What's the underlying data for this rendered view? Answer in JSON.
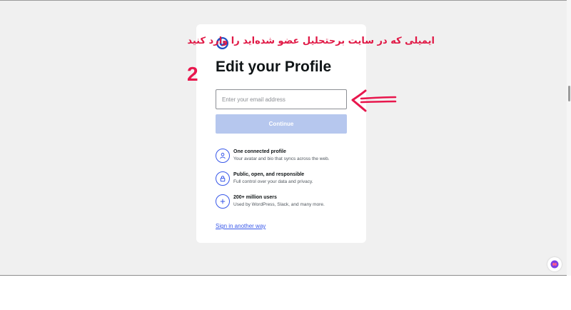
{
  "annotation": {
    "text": "ایمیلی که در سایت برحتحلیل عضو شده‌اید را وارد کنید",
    "color": "#e01845"
  },
  "step": {
    "number": "2"
  },
  "card": {
    "title": "Edit your Profile",
    "email_placeholder": "Enter your email address",
    "email_value": "",
    "continue_label": "Continue",
    "features": [
      {
        "icon": "user-icon",
        "title": "One connected profile",
        "description": "Your avatar and bio that syncs across the web."
      },
      {
        "icon": "lock-icon",
        "title": "Public, open, and responsible",
        "description": "Full control over your data and privacy."
      },
      {
        "icon": "plus-icon",
        "title": "200+ million users",
        "description": "Used by WordPress, Slack, and many more."
      }
    ],
    "sign_in_link": "Sign in another way"
  },
  "colors": {
    "accent": "#3858e9",
    "button_disabled": "#b6c7ee",
    "annotation": "#e8174d"
  }
}
